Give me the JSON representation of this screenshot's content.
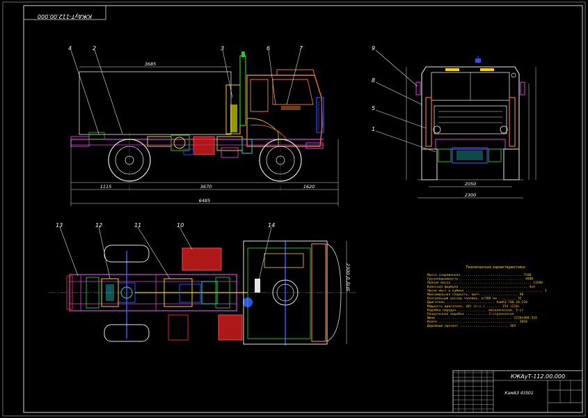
{
  "drawing": {
    "corner_code": "КЖАуТ-112.00.000",
    "title_code": "КЖАуТ-112.00.000",
    "title_name": "КамАЗ 43501"
  },
  "callouts": [
    "4",
    "2",
    "3",
    "6",
    "7",
    "9",
    "8",
    "5",
    "1",
    "13",
    "12",
    "11",
    "10",
    "14"
  ],
  "dims": {
    "side_top": "3685",
    "side_rear": "1115",
    "side_wheelbase": "3670",
    "side_front": "1620",
    "side_total": "6485",
    "front_track": "2050",
    "front_width": "2300",
    "plan_width": "2300 Д.ДЦБ"
  },
  "specs": {
    "title": "Техническая характеристика",
    "lines": [
      "Масса снаряженная ............................... 7580",
      "Грузоподъемность ................................. 4000",
      "Полная масса ......................................... 11580",
      "Колесная формула ................................... 4x4",
      "Число мест в кабине ........................................ 3",
      "Максимальная скорость, км/ч ................... 90",
      "Контрольный расход топлива, л/100 км ......... 32",
      "Двигатель ......................... КамАЗ-740.10-210",
      "Мощность двигателя, кВт (л.с.) ....... 154 (210)",
      "Коробка передач ............... механическая, 5-ст",
      "Раздаточная коробка ........... 2-ступенчатая",
      "Шины ....................................... 1220x400-533",
      "Колея ......................................... 2050",
      "Дорожный просвет ......................... 365"
    ]
  },
  "colors": {
    "background": "#000000",
    "linework": "#ffffff",
    "cab": "#e8782a",
    "frame": "#e040e0",
    "engine": "#22d8d8",
    "tank": "#e82020",
    "axle": "#3050ff",
    "green": "#20d020",
    "yellow": "#ffd200"
  }
}
